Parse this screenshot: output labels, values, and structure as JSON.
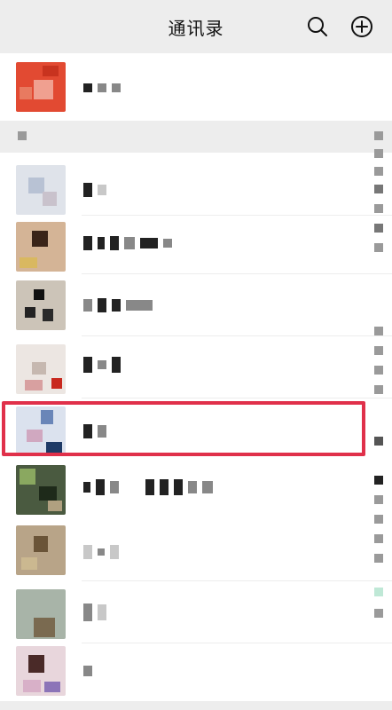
{
  "header": {
    "title": "通讯录",
    "search_icon": "search-icon",
    "add_icon": "add-circle-icon"
  },
  "colors": {
    "header_bg": "#ededed",
    "highlight": "#e0304a",
    "divider": "#ededed"
  },
  "top_entry": {
    "label": ""
  },
  "section": {
    "letter": ""
  },
  "contacts": [
    {
      "name": ""
    },
    {
      "name": ""
    },
    {
      "name": ""
    },
    {
      "name": ""
    },
    {
      "name": ""
    },
    {
      "name": ""
    },
    {
      "name": ""
    },
    {
      "name": ""
    },
    {
      "name": ""
    }
  ]
}
